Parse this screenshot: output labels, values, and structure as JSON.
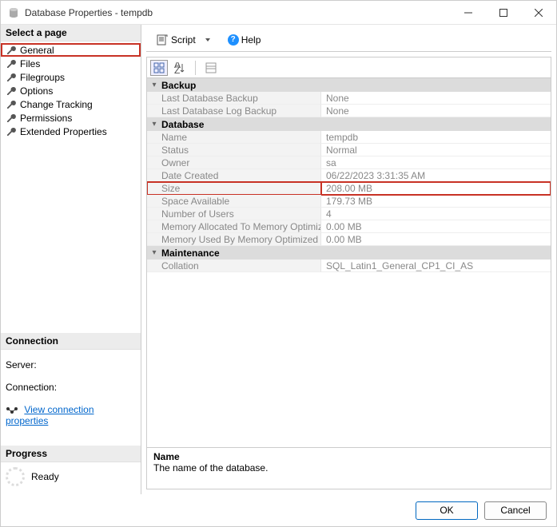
{
  "window": {
    "title": "Database Properties - tempdb"
  },
  "sidebar": {
    "selectHeader": "Select a page",
    "pages": [
      {
        "label": "General"
      },
      {
        "label": "Files"
      },
      {
        "label": "Filegroups"
      },
      {
        "label": "Options"
      },
      {
        "label": "Change Tracking"
      },
      {
        "label": "Permissions"
      },
      {
        "label": "Extended Properties"
      }
    ],
    "connectionHeader": "Connection",
    "serverLabel": "Server:",
    "connectionLabel": "Connection:",
    "viewConnLink": "View connection properties",
    "progressHeader": "Progress",
    "progressStatus": "Ready"
  },
  "toolbar": {
    "script": "Script",
    "help": "Help"
  },
  "propGrid": {
    "categories": [
      {
        "name": "Backup",
        "rows": [
          {
            "name": "Last Database Backup",
            "value": "None"
          },
          {
            "name": "Last Database Log Backup",
            "value": "None"
          }
        ]
      },
      {
        "name": "Database",
        "rows": [
          {
            "name": "Name",
            "value": "tempdb"
          },
          {
            "name": "Status",
            "value": "Normal"
          },
          {
            "name": "Owner",
            "value": "sa"
          },
          {
            "name": "Date Created",
            "value": "06/22/2023 3:31:35 AM"
          },
          {
            "name": "Size",
            "value": "208.00 MB",
            "highlight": true
          },
          {
            "name": "Space Available",
            "value": "179.73 MB"
          },
          {
            "name": "Number of Users",
            "value": "4"
          },
          {
            "name": "Memory Allocated To Memory Optimized Obje",
            "value": "0.00 MB"
          },
          {
            "name": "Memory Used By Memory Optimized Objects",
            "value": "0.00 MB"
          }
        ]
      },
      {
        "name": "Maintenance",
        "rows": [
          {
            "name": "Collation",
            "value": "SQL_Latin1_General_CP1_CI_AS"
          }
        ]
      }
    ],
    "desc": {
      "title": "Name",
      "text": "The name of the database."
    }
  },
  "footer": {
    "ok": "OK",
    "cancel": "Cancel"
  }
}
